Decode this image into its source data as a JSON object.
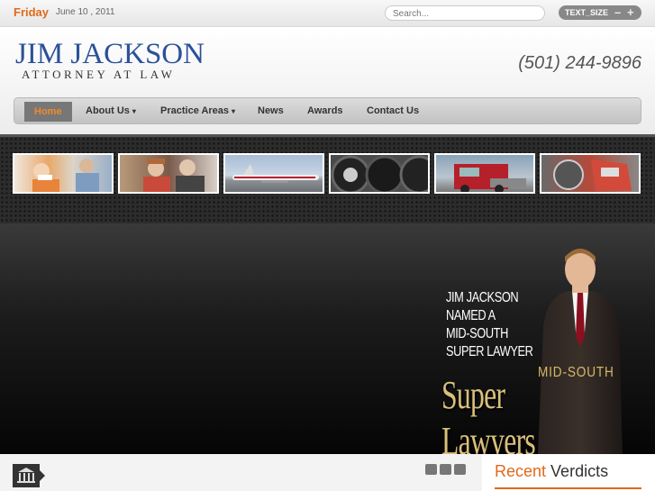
{
  "topbar": {
    "day": "Friday",
    "date": "June 10 , 2011",
    "search_placeholder": "Search...",
    "text_size_label": "TEXT_SIZE",
    "decrease": "–",
    "increase": "+"
  },
  "header": {
    "logo_name": "JIM JACKSON",
    "logo_sub": "ATTORNEY AT LAW",
    "phone": "(501) 244-9896"
  },
  "nav": {
    "items": [
      {
        "label": "Home"
      },
      {
        "label": "About Us"
      },
      {
        "label": "Practice Areas"
      },
      {
        "label": "News"
      },
      {
        "label": "Awards"
      },
      {
        "label": "Contact Us"
      }
    ],
    "caret": "▾"
  },
  "gallery": {
    "thumbs": [
      "injury",
      "elderly-couple",
      "airplane",
      "tires",
      "truck",
      "car-wreck"
    ]
  },
  "hero": {
    "line1": "JIM JACKSON",
    "line2": "NAMED A",
    "line3": "MID-SOUTH",
    "line4": "SUPER LAWYER",
    "badge_top": "MID-SOUTH",
    "badge_main": "Super Lawyers"
  },
  "recent": {
    "word1": "Recent",
    "word2": " Verdicts"
  },
  "colors": {
    "accent": "#e06a1b",
    "logo_blue": "#2a5298",
    "gold": "#d9c07a"
  }
}
